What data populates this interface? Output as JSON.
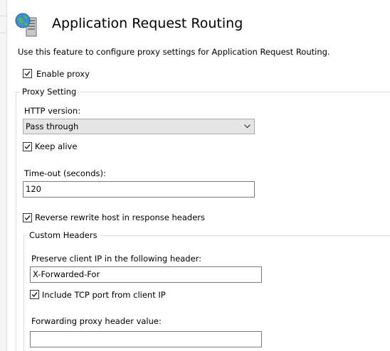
{
  "header": {
    "title": "Application Request Routing",
    "icon": "server-globe-icon"
  },
  "description": "Use this feature to configure proxy settings for Application Request Routing.",
  "enable_proxy": {
    "label": "Enable proxy",
    "checked": true
  },
  "proxy_setting": {
    "legend": "Proxy Setting",
    "http_version": {
      "label": "HTTP version:",
      "value": "Pass through"
    },
    "keep_alive": {
      "label": "Keep alive",
      "checked": true
    },
    "timeout": {
      "label": "Time-out (seconds):",
      "value": "120"
    },
    "reverse_rewrite": {
      "label": "Reverse rewrite host in response headers",
      "checked": true
    }
  },
  "custom_headers": {
    "legend": "Custom Headers",
    "preserve_ip": {
      "label": "Preserve client IP in the following header:",
      "value": "X-Forwarded-For"
    },
    "include_tcp_port": {
      "label": "Include TCP port from client IP",
      "checked": true
    },
    "forwarding_proxy": {
      "label": "Forwarding proxy header value:",
      "value": ""
    }
  },
  "colors": {
    "field_border": "#7a7a7a",
    "group_border": "#dcdcdc",
    "select_bg": "#e5e5e5"
  }
}
